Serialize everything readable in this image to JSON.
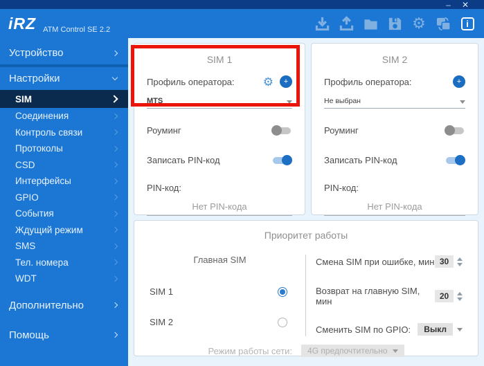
{
  "titlebar": {
    "minimize_label": "–",
    "close_label": "✕"
  },
  "header": {
    "logo_text": "iRZ",
    "app_title": "ATM Control SE 2.2",
    "toolbar_icons": [
      "download",
      "upload",
      "open-folder",
      "save",
      "settings",
      "language-switch",
      "info"
    ]
  },
  "sidebar": {
    "items": [
      {
        "label": "Устройство",
        "level": "parent",
        "state": "collapsed"
      },
      {
        "label": "Настройки",
        "level": "parent",
        "state": "expanded"
      },
      {
        "label": "SIM",
        "level": "child",
        "state": "selected"
      },
      {
        "label": "Соединения",
        "level": "child"
      },
      {
        "label": "Контроль связи",
        "level": "child"
      },
      {
        "label": "Протоколы",
        "level": "child"
      },
      {
        "label": "CSD",
        "level": "child"
      },
      {
        "label": "Интерфейсы",
        "level": "child"
      },
      {
        "label": "GPIO",
        "level": "child"
      },
      {
        "label": "События",
        "level": "child"
      },
      {
        "label": "Ждущий режим",
        "level": "child"
      },
      {
        "label": "SMS",
        "level": "child"
      },
      {
        "label": "Тел. номера",
        "level": "child"
      },
      {
        "label": "WDT",
        "level": "child"
      },
      {
        "label": "Дополнительно",
        "level": "parent",
        "state": "collapsed"
      },
      {
        "label": "Помощь",
        "level": "parent",
        "state": "collapsed"
      }
    ]
  },
  "sim1": {
    "title": "SIM 1",
    "operator_profile_label": "Профиль оператора:",
    "operator_value": "MTS",
    "roaming_label": "Роуминг",
    "roaming_on": false,
    "write_pin_label": "Записать PIN-код",
    "write_pin_on": true,
    "pin_label": "PIN-код:",
    "pin_placeholder": "Нет PIN-кода"
  },
  "sim2": {
    "title": "SIM 2",
    "operator_profile_label": "Профиль оператора:",
    "operator_value": "Не выбран",
    "roaming_label": "Роуминг",
    "roaming_on": false,
    "write_pin_label": "Записать PIN-код",
    "write_pin_on": true,
    "pin_label": "PIN-код:",
    "pin_placeholder": "Нет PIN-кода"
  },
  "priority": {
    "title": "Приоритет работы",
    "main_sim_label": "Главная SIM",
    "options": [
      {
        "label": "SIM 1",
        "selected": true
      },
      {
        "label": "SIM 2",
        "selected": false
      }
    ],
    "fields": [
      {
        "label": "Смена SIM при ошибке, мин",
        "value": "30",
        "control": "spinner"
      },
      {
        "label": "Возврат на главную SIM, мин",
        "value": "20",
        "control": "spinner"
      },
      {
        "label": "Сменить SIM по GPIO:",
        "value": "Выкл",
        "control": "select"
      }
    ],
    "network_mode_label": "Режим работы сети:",
    "network_mode_value": "4G предпочтительно",
    "network_mode_disabled": true
  },
  "colors": {
    "header_blue": "#1b76d4",
    "titlebar_navy": "#0c3c86",
    "selected_navy": "#0a2b4e",
    "accent_blue": "#1d6fc4",
    "highlight_red": "#ea1409",
    "main_bg": "#e9f3fb"
  }
}
